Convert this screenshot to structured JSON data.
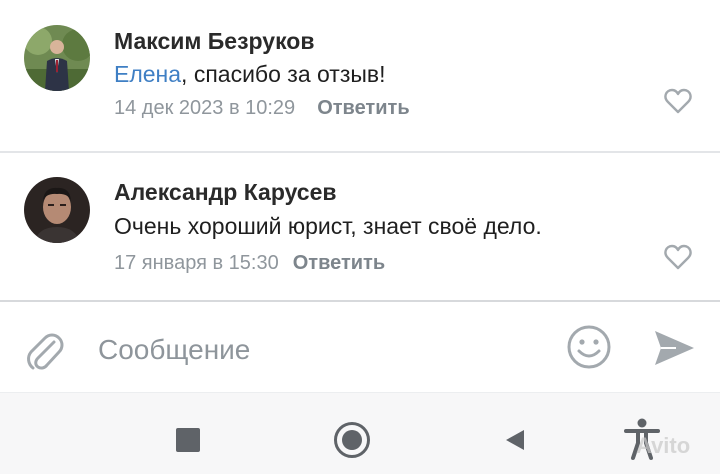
{
  "comments": [
    {
      "author": "Максим Безруков",
      "mention": "Елена",
      "text": ", спасибо за отзыв!",
      "date": "14 дек 2023 в 10:29",
      "reply_label": "Ответить"
    },
    {
      "author": "Александр Карусев",
      "text": "Очень хороший юрист, знает своё дело.",
      "date": "17 января в 15:30",
      "reply_label": "Ответить"
    }
  ],
  "composer": {
    "placeholder": "Сообщение"
  },
  "watermark": "Avito",
  "icons": {
    "like": "heart-outline-icon",
    "attach": "paperclip-icon",
    "emoji": "smiley-icon",
    "send": "send-arrow-icon"
  },
  "colors": {
    "mention": "#3f7fc4",
    "meta": "#8f969c",
    "icon": "#a3a9ae"
  }
}
